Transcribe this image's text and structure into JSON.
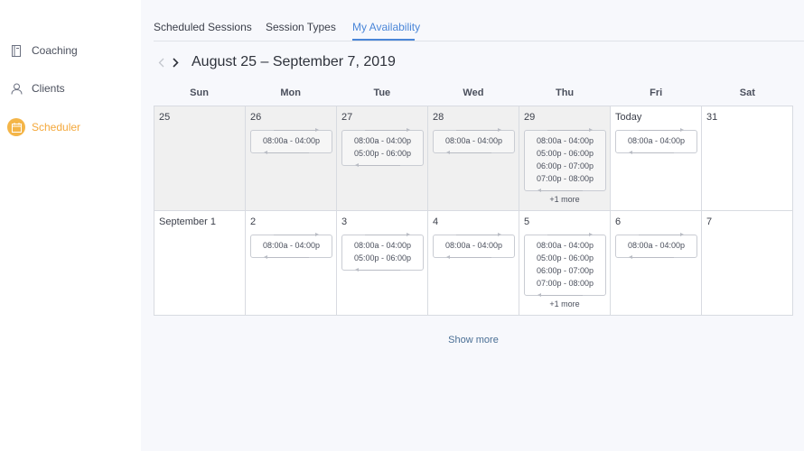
{
  "sidebar": {
    "items": [
      {
        "label": "Coaching",
        "icon": "notebook-icon",
        "active": false
      },
      {
        "label": "Clients",
        "icon": "user-icon",
        "active": false
      },
      {
        "label": "Scheduler",
        "icon": "calendar-icon",
        "active": true
      }
    ]
  },
  "tabs": [
    {
      "label": "Scheduled Sessions",
      "active": false
    },
    {
      "label": "Session Types",
      "active": false
    },
    {
      "label": "My Availability",
      "active": true
    }
  ],
  "calendar": {
    "range_title": "August 25 – September 7, 2019",
    "prev_icon": "chevron-left-icon",
    "next_icon": "chevron-right-icon",
    "weekdays": [
      "Sun",
      "Mon",
      "Tue",
      "Wed",
      "Thu",
      "Fri",
      "Sat"
    ],
    "weeks": [
      [
        {
          "label": "25",
          "past": true,
          "slots": [],
          "more": ""
        },
        {
          "label": "26",
          "past": true,
          "slots": [
            "08:00a - 04:00p"
          ],
          "more": ""
        },
        {
          "label": "27",
          "past": true,
          "slots": [
            "08:00a - 04:00p",
            "05:00p - 06:00p"
          ],
          "more": ""
        },
        {
          "label": "28",
          "past": true,
          "slots": [
            "08:00a - 04:00p"
          ],
          "more": ""
        },
        {
          "label": "29",
          "past": true,
          "slots": [
            "08:00a - 04:00p",
            "05:00p - 06:00p",
            "06:00p - 07:00p",
            "07:00p - 08:00p"
          ],
          "more": "+1 more"
        },
        {
          "label": "Today",
          "past": false,
          "slots": [
            "08:00a - 04:00p"
          ],
          "more": ""
        },
        {
          "label": "31",
          "past": false,
          "slots": [],
          "more": ""
        }
      ],
      [
        {
          "label": "September 1",
          "past": false,
          "slots": [],
          "more": ""
        },
        {
          "label": "2",
          "past": false,
          "slots": [
            "08:00a - 04:00p"
          ],
          "more": ""
        },
        {
          "label": "3",
          "past": false,
          "slots": [
            "08:00a - 04:00p",
            "05:00p - 06:00p"
          ],
          "more": ""
        },
        {
          "label": "4",
          "past": false,
          "slots": [
            "08:00a - 04:00p"
          ],
          "more": ""
        },
        {
          "label": "5",
          "past": false,
          "slots": [
            "08:00a - 04:00p",
            "05:00p - 06:00p",
            "06:00p - 07:00p",
            "07:00p - 08:00p"
          ],
          "more": "+1 more"
        },
        {
          "label": "6",
          "past": false,
          "slots": [
            "08:00a - 04:00p"
          ],
          "more": ""
        },
        {
          "label": "7",
          "past": false,
          "slots": [],
          "more": ""
        }
      ]
    ],
    "show_more_label": "Show more"
  },
  "colors": {
    "accent": "#4a86d8",
    "scheduler_orange": "#f4a83b",
    "past_day_bg": "#f0f0f0",
    "page_bg": "#f7f8fc"
  }
}
